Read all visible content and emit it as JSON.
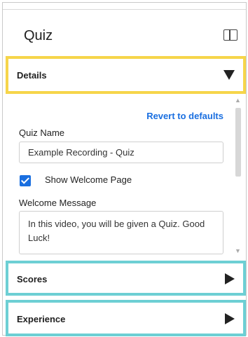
{
  "panel": {
    "title": "Quiz",
    "toggle_icon": "panel-layout-icon"
  },
  "details": {
    "label": "Details",
    "expand_icon": "triangle-down-icon",
    "revert_label": "Revert to defaults",
    "quiz_name_label": "Quiz Name",
    "quiz_name_value": "Example Recording - Quiz",
    "show_welcome_label": "Show Welcome Page",
    "show_welcome_checked": true,
    "welcome_message_label": "Welcome Message",
    "welcome_message_value": "In this video, you will be given a Quiz. Good Luck!"
  },
  "sections": {
    "scores_label": "Scores",
    "experience_label": "Experience",
    "collapsed_icon": "triangle-right-icon"
  },
  "colors": {
    "details_highlight": "#f6d54a",
    "section_highlight": "#6dcfd4",
    "accent": "#1a6fe0"
  }
}
